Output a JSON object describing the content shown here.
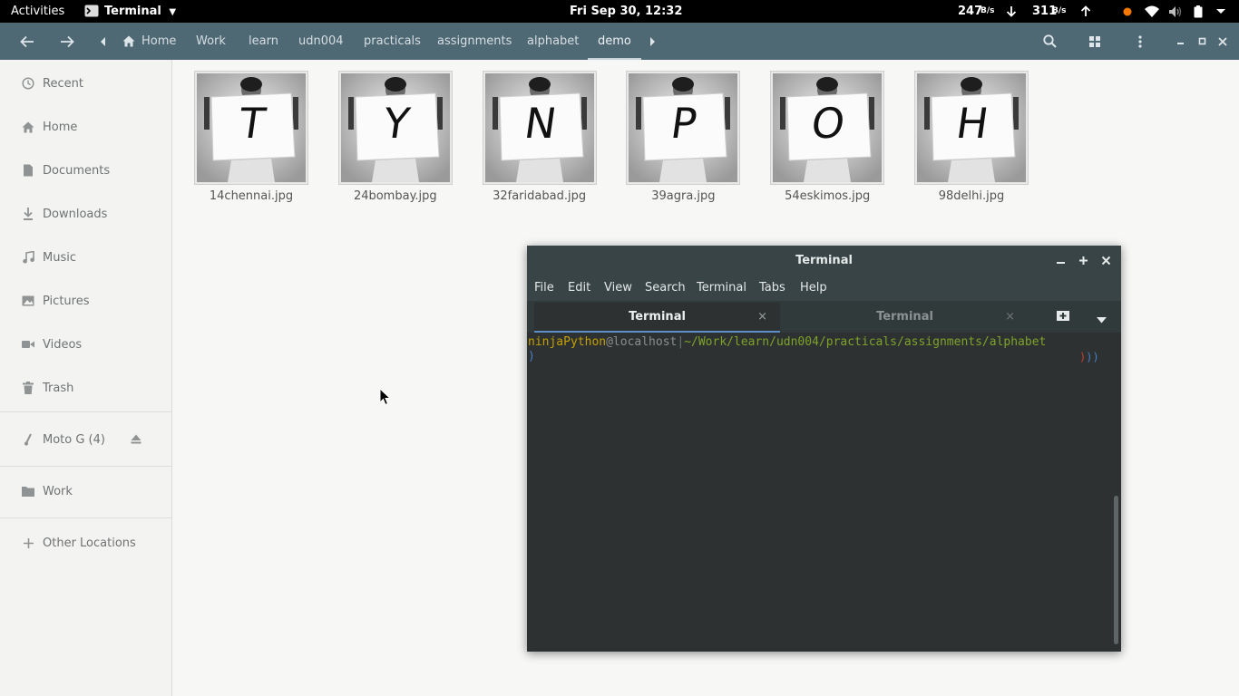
{
  "topbar": {
    "activities": "Activities",
    "app_name": "Terminal",
    "clock": "Fri Sep 30, 12:32",
    "net_down_value": "247",
    "net_down_unit": "B/s",
    "net_up_value": "311",
    "net_up_unit": "B/s"
  },
  "files": {
    "breadcrumbs": [
      "Home",
      "Work",
      "learn",
      "udn004",
      "practicals",
      "assignments",
      "alphabet",
      "demo"
    ],
    "sidebar": {
      "recent": "Recent",
      "home": "Home",
      "documents": "Documents",
      "downloads": "Downloads",
      "music": "Music",
      "pictures": "Pictures",
      "videos": "Videos",
      "trash": "Trash",
      "device": "Moto G (4)",
      "work": "Work",
      "other_locations": "Other Locations"
    },
    "items": [
      {
        "name": "14chennai.jpg",
        "letter": "T"
      },
      {
        "name": "24bombay.jpg",
        "letter": "Y"
      },
      {
        "name": "32faridabad.jpg",
        "letter": "N"
      },
      {
        "name": "39agra.jpg",
        "letter": "P"
      },
      {
        "name": "54eskimos.jpg",
        "letter": "O"
      },
      {
        "name": "98delhi.jpg",
        "letter": "H"
      }
    ]
  },
  "terminal": {
    "title": "Terminal",
    "menu": [
      "File",
      "Edit",
      "View",
      "Search",
      "Terminal",
      "Tabs",
      "Help"
    ],
    "tabs": [
      {
        "label": "Terminal",
        "active": true
      },
      {
        "label": "Terminal",
        "active": false
      }
    ],
    "prompt": {
      "user": "ninjaPython",
      "at": "@",
      "host": "localhost",
      "sep": "|",
      "path": "~/Work/learn/udn004/practicals/assignments/alphabet",
      "caret": ")",
      "right_marks": ")))"
    }
  },
  "colors": {
    "header_bg": "#4e6874",
    "terminal_bg": "#2d3131",
    "prompt_user": "#c4a000",
    "prompt_host": "#8d8d8d",
    "prompt_path": "#7fa32a",
    "prompt_caret": "#4a7ec8"
  }
}
